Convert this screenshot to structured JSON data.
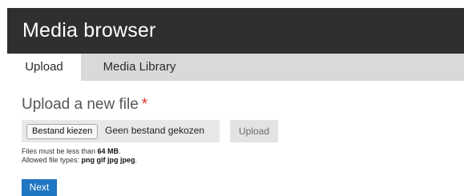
{
  "header": {
    "title": "Media browser"
  },
  "tabs": [
    {
      "label": "Upload",
      "active": true
    },
    {
      "label": "Media Library",
      "active": false
    }
  ],
  "upload": {
    "heading": "Upload a new file",
    "required_marker": "*",
    "choose_button_label": "Bestand kiezen",
    "file_status": "Geen bestand gekozen",
    "upload_button_label": "Upload",
    "size_prefix": "Files must be less than ",
    "size_value": "64 MB",
    "size_suffix": ".",
    "types_prefix": "Allowed file types: ",
    "types_value": "png gif jpg jpeg",
    "types_suffix": "."
  },
  "actions": {
    "next_label": "Next"
  },
  "colors": {
    "header_bg": "#2f2f2f",
    "tab_bar_bg": "#d9d9d9",
    "required": "#e32b2b",
    "primary_button": "#1f76c2"
  }
}
